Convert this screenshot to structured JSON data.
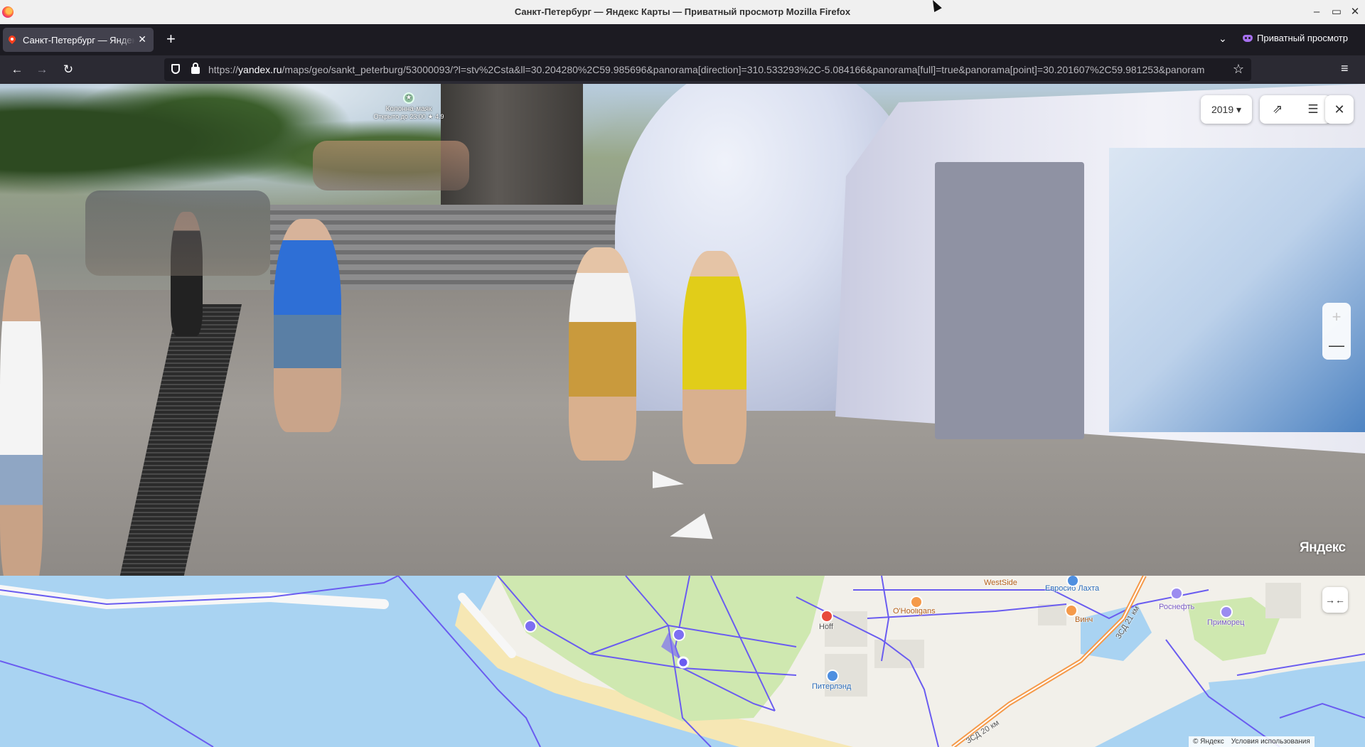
{
  "window": {
    "title": "Санкт-Петербург — Яндекс Карты — Приватный просмотр Mozilla Firefox",
    "controls": {
      "minimize": "–",
      "maximize": "▭",
      "close": "✕"
    }
  },
  "tabs": [
    {
      "label": "Санкт-Петербург — Яндекс Карты",
      "favicon": "yandex-maps-pin-icon",
      "active": true
    }
  ],
  "tabstrip": {
    "new_tab": "+",
    "list_tabs": "⌄",
    "private_browsing_label": "Приватный просмотр"
  },
  "navbar": {
    "back": "←",
    "forward": "→",
    "reload": "↻",
    "url_prefix": "https://",
    "url_host": "yandex.ru",
    "url_rest": "/maps/geo/sankt_peterburg/53000093/?l=stv%2Csta&ll=30.204280%2C59.985696&panorama[direction]=310.533293%2C-5.084166&panorama[full]=true&panorama[point]=30.201607%2C59.981253&panoram",
    "bookmark": "☆",
    "menu": "≡"
  },
  "panorama": {
    "poi": {
      "name": "Колонна-маяк",
      "status": "Открыто до 23:00",
      "rating": "★ 4.9"
    },
    "year_selector": "2019 ▾",
    "share_icon": "⇗",
    "list_icon": "☰",
    "close_icon": "✕",
    "zoom_in": "+",
    "zoom_out": "—",
    "watermark": "Яндекс"
  },
  "minimap": {
    "collapse_icon": "→←",
    "labels": [
      {
        "text": "WestSide",
        "color": "#b35e18"
      },
      {
        "text": "Евросиб Лахта",
        "color": "#2a6bb8"
      },
      {
        "text": "O'Hooligans",
        "color": "#b35e18"
      },
      {
        "text": "Роснефть",
        "color": "#7a5bc4"
      },
      {
        "text": "Приморец",
        "color": "#7a5bc4"
      },
      {
        "text": "Винч",
        "color": "#b35e18"
      },
      {
        "text": "Hoff",
        "color": "#555555"
      },
      {
        "text": "Питерлэнд",
        "color": "#2a6bb8"
      },
      {
        "text": "ЗСД 21 км",
        "color": "#555555"
      },
      {
        "text": "ЗСД 20 км",
        "color": "#555555"
      }
    ],
    "copyright": "© Яндекс",
    "terms": "Условия использования"
  }
}
